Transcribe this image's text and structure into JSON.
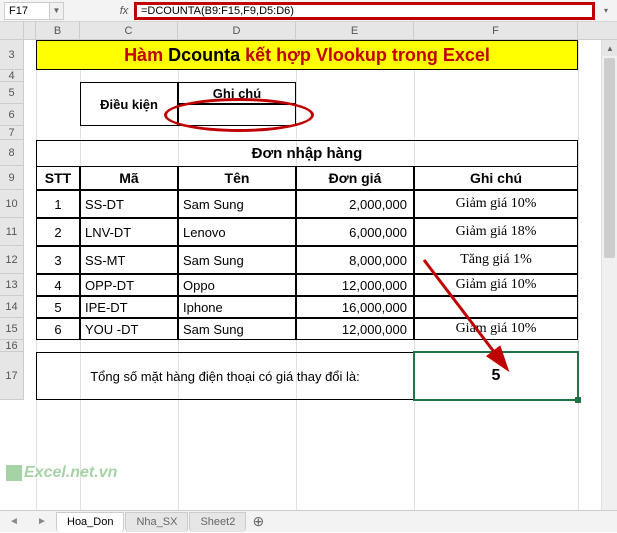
{
  "nameBox": "F17",
  "fxLabel": "fx",
  "formula": "=DCOUNTA(B9:F15,F9,D5:D6)",
  "columns": [
    "B",
    "C",
    "D",
    "E",
    "F"
  ],
  "rowLabels": [
    "3",
    "4",
    "5",
    "6",
    "7",
    "8",
    "9",
    "10",
    "11",
    "12",
    "13",
    "14",
    "15",
    "16",
    "17"
  ],
  "title": {
    "part1": "Hàm ",
    "part2": "Dcounta",
    "part3": "  kết hợp Vlookup trong Excel"
  },
  "condition": {
    "label": "Điều kiện",
    "noteHeader": "Ghi chú"
  },
  "tableTitle": "Đơn nhập hàng",
  "headers": {
    "stt": "STT",
    "ma": "Mã",
    "ten": "Tên",
    "dongia": "Đơn giá",
    "ghichu": "Ghi chú"
  },
  "rows": [
    {
      "stt": "1",
      "ma": "SS-DT",
      "ten": "Sam Sung",
      "gia": "2,000,000",
      "note": "Giảm giá 10%"
    },
    {
      "stt": "2",
      "ma": "LNV-DT",
      "ten": "Lenovo",
      "gia": "6,000,000",
      "note": "Giảm giá 18%"
    },
    {
      "stt": "3",
      "ma": "SS-MT",
      "ten": "Sam Sung",
      "gia": "8,000,000",
      "note": "Tăng giá 1%"
    },
    {
      "stt": "4",
      "ma": "OPP-DT",
      "ten": "Oppo",
      "gia": "12,000,000",
      "note": "Giảm giá 10%"
    },
    {
      "stt": "5",
      "ma": "IPE-DT",
      "ten": "Iphone",
      "gia": "16,000,000",
      "note": ""
    },
    {
      "stt": "6",
      "ma": "YOU -DT",
      "ten": "Sam Sung",
      "gia": "12,000,000",
      "note": "Giảm giá 10%"
    }
  ],
  "summary": "Tổng số mặt hàng điện thoại có giá thay đổi là:",
  "result": "5",
  "watermark": "Excel.net.vn",
  "tabs": {
    "active": "Hoa_Don",
    "others": [
      "Nha_SX",
      "Sheet2"
    ]
  },
  "colWidths": {
    "A": 12,
    "B": 44,
    "C": 98,
    "D": 118,
    "E": 118,
    "F": 164
  },
  "rowHeights": {
    "3": 30,
    "4": 12,
    "5": 22,
    "6": 22,
    "7": 14,
    "8": 26,
    "9": 24,
    "10": 28,
    "11": 28,
    "12": 28,
    "13": 22,
    "14": 22,
    "15": 22,
    "16": 12,
    "17": 48
  }
}
